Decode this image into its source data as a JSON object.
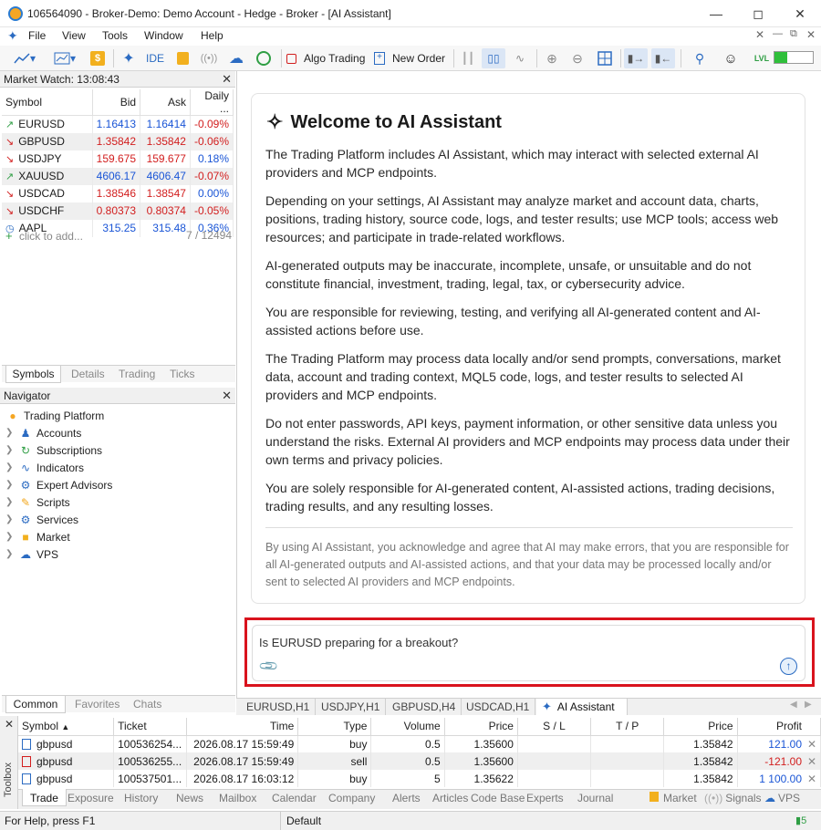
{
  "window": {
    "title": "106564090 - Broker-Demo: Demo Account - Hedge - Broker - [AI Assistant]"
  },
  "menu": [
    "File",
    "View",
    "Tools",
    "Window",
    "Help"
  ],
  "toolbar": {
    "ide": "IDE",
    "algo_trading": "Algo Trading",
    "new_order": "New Order"
  },
  "market_watch": {
    "title": "Market Watch: 13:08:43",
    "headers": [
      "Symbol",
      "Bid",
      "Ask",
      "Daily ..."
    ],
    "rows": [
      {
        "symbol": "EURUSD",
        "bid": "1.16413",
        "ask": "1.16414",
        "daily": "-0.09%",
        "dir": "up"
      },
      {
        "symbol": "GBPUSD",
        "bid": "1.35842",
        "ask": "1.35842",
        "daily": "-0.06%",
        "dir": "dn"
      },
      {
        "symbol": "USDJPY",
        "bid": "159.675",
        "ask": "159.677",
        "daily": "0.18%",
        "dir": "dn"
      },
      {
        "symbol": "XAUUSD",
        "bid": "4606.17",
        "ask": "4606.47",
        "daily": "-0.07%",
        "dir": "up"
      },
      {
        "symbol": "USDCAD",
        "bid": "1.38546",
        "ask": "1.38547",
        "daily": "0.00%",
        "dir": "dn"
      },
      {
        "symbol": "USDCHF",
        "bid": "0.80373",
        "ask": "0.80374",
        "daily": "-0.05%",
        "dir": "dn"
      },
      {
        "symbol": "AAPL",
        "bid": "315.25",
        "ask": "315.48",
        "daily": "0.36%",
        "dir": "up"
      }
    ],
    "add_placeholder": "click to add...",
    "count": "7 / 12494",
    "tabs": [
      "Symbols",
      "Details",
      "Trading",
      "Ticks"
    ]
  },
  "navigator": {
    "title": "Navigator",
    "root": "Trading Platform",
    "items": [
      "Accounts",
      "Subscriptions",
      "Indicators",
      "Expert Advisors",
      "Scripts",
      "Services",
      "Market",
      "VPS"
    ],
    "tabs": [
      "Common",
      "Favorites",
      "Chats"
    ]
  },
  "assistant": {
    "heading": "Welcome to AI Assistant",
    "paragraphs": [
      "The Trading Platform includes AI Assistant, which may interact with selected external AI providers and MCP endpoints.",
      "Depending on your settings, AI Assistant may analyze market and account data, charts, positions, trading history, source code, logs, and tester results; use MCP tools; access web resources; and participate in trade-related workflows.",
      "AI-generated outputs may be inaccurate, incomplete, unsafe, or unsuitable and do not constitute financial, investment, trading, legal, tax, or cybersecurity advice.",
      "You are responsible for reviewing, testing, and verifying all AI-generated content and AI-assisted actions before use.",
      "The Trading Platform may process data locally and/or send prompts, conversations, market data, account and trading context, MQL5 code, logs, and tester results to selected AI providers and MCP endpoints.",
      "Do not enter passwords, API keys, payment information, or other sensitive data unless you understand the risks. External AI providers and MCP endpoints may process data under their own terms and privacy policies.",
      "You are solely responsible for AI-generated content, AI-assisted actions, trading decisions, trading results, and any resulting losses."
    ],
    "disclaimer": "By using AI Assistant, you acknowledge and agree that AI may make errors, that you are responsible for all AI-generated outputs and AI-assisted actions, and that your data may be processed locally and/or sent to selected AI providers and MCP endpoints.",
    "input_value": "Is EURUSD preparing for a breakout?"
  },
  "chart_tabs": [
    "EURUSD,H1",
    "USDJPY,H1",
    "GBPUSD,H4",
    "USDCAD,H1",
    "AI Assistant"
  ],
  "trade": {
    "headers": [
      "Symbol",
      "Ticket",
      "Time",
      "Type",
      "Volume",
      "Price",
      "S / L",
      "T / P",
      "Price",
      "Profit"
    ],
    "rows": [
      {
        "symbol": "gbpusd",
        "ticket": "100536254...",
        "time": "2026.08.17 15:59:49",
        "type": "buy",
        "volume": "0.5",
        "price": "1.35600",
        "sl": "",
        "tp": "",
        "cur": "1.35842",
        "profit": "121.00",
        "pc": "up"
      },
      {
        "symbol": "gbpusd",
        "ticket": "100536255...",
        "time": "2026.08.17 15:59:49",
        "type": "sell",
        "volume": "0.5",
        "price": "1.35600",
        "sl": "",
        "tp": "",
        "cur": "1.35842",
        "profit": "-121.00",
        "pc": "dn"
      },
      {
        "symbol": "gbpusd",
        "ticket": "100537501...",
        "time": "2026.08.17 16:03:12",
        "type": "buy",
        "volume": "5",
        "price": "1.35622",
        "sl": "",
        "tp": "",
        "cur": "1.35842",
        "profit": "1 100.00",
        "pc": "up"
      }
    ],
    "toolbox_label": "Toolbox",
    "tabs": [
      "Trade",
      "Exposure",
      "History",
      "News",
      "Mailbox",
      "Calendar",
      "Company",
      "Alerts",
      "Articles",
      "Code Base",
      "Experts",
      "Journal",
      "Market",
      "Signals",
      "VPS"
    ]
  },
  "status": {
    "help": "For Help, press F1",
    "profile": "Default",
    "signal": "5"
  },
  "colors": {
    "accent": "#2b6bc2",
    "highlight": "#d9131d",
    "up": "#1a55d6",
    "down": "#d21e1e"
  }
}
